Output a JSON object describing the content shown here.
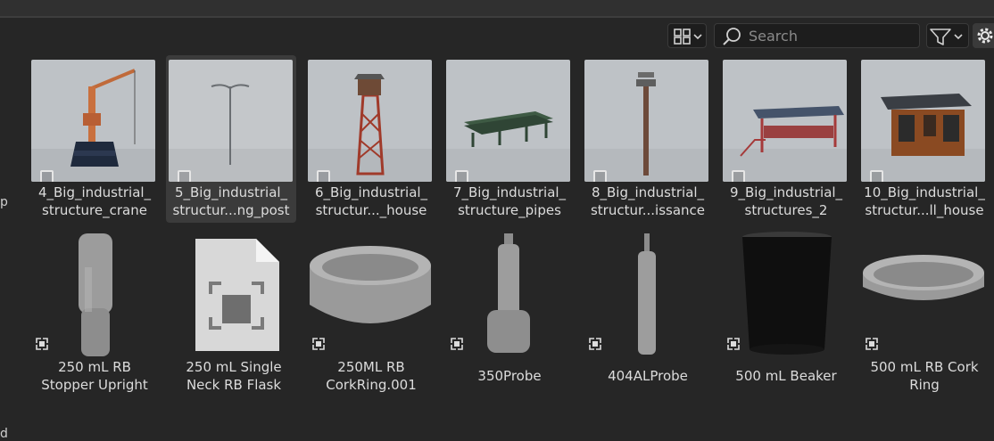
{
  "toolbar": {
    "search": {
      "placeholder": "Search",
      "value": ""
    },
    "view_icon": "grid-view-icon",
    "filter_icon": "filter-icon",
    "settings_icon": "gear-icon"
  },
  "left_strip": {
    "glyphs": [
      "p",
      "d"
    ]
  },
  "assets_row1": [
    {
      "line1": "4_Big_industrial_",
      "line2": "structure_crane",
      "icon": "crane-thumbnail"
    },
    {
      "line1": "5_Big_industrial_",
      "line2": "structur...ng_post",
      "icon": "lamp-post-thumbnail",
      "selected": true
    },
    {
      "line1": "6_Big_industrial_",
      "line2": "structur..._house",
      "icon": "tower-house-thumbnail"
    },
    {
      "line1": "7_Big_industrial_",
      "line2": "structure_pipes",
      "icon": "pipes-thumbnail"
    },
    {
      "line1": "8_Big_industrial_",
      "line2": "structur...issance",
      "icon": "reconnaissance-tower-thumbnail"
    },
    {
      "line1": "9_Big_industrial_",
      "line2": "structures_2",
      "icon": "platform-thumbnail"
    },
    {
      "line1": "10_Big_industrial_",
      "line2": "structur...ll_house",
      "icon": "small-house-thumbnail"
    }
  ],
  "assets_row2": [
    {
      "line1": "250 mL RB",
      "line2": "Stopper Upright",
      "icon": "stopper-thumbnail"
    },
    {
      "line1": "250 mL Single",
      "line2": "Neck RB Flask",
      "icon": "file-placeholder-icon"
    },
    {
      "line1": "250ML RB",
      "line2": "CorkRing.001",
      "icon": "cork-ring-thumbnail"
    },
    {
      "line1": "350Probe",
      "line2": "",
      "icon": "probe-thumbnail"
    },
    {
      "line1": "404ALProbe",
      "line2": "",
      "icon": "probe-thumbnail"
    },
    {
      "line1": "500 mL Beaker",
      "line2": "",
      "icon": "beaker-thumbnail"
    },
    {
      "line1": "500 mL RB Cork",
      "line2": "Ring",
      "icon": "cork-ring-thumbnail"
    }
  ],
  "colors": {
    "background": "#262626",
    "selected_tile": "#3b3b3b",
    "thumb_bg": "#bfc3c6",
    "text": "#dcdcdc"
  }
}
